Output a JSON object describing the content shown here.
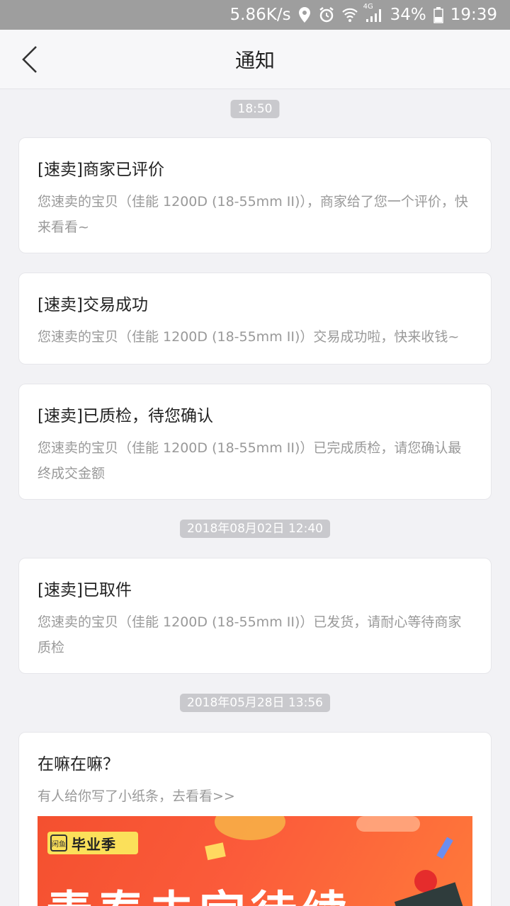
{
  "status_bar": {
    "speed": "5.86K/s",
    "network": "4G",
    "battery": "34%",
    "time": "19:39"
  },
  "nav": {
    "title": "通知",
    "back_icon": "chevron-left-icon"
  },
  "groups": [
    {
      "timestamp": "18:50",
      "notifications": [
        {
          "title": "[速卖]商家已评价",
          "body": "您速卖的宝贝（佳能 1200D (18-55mm II)），商家给了您一个评价，快来看看~"
        },
        {
          "title": "[速卖]交易成功",
          "body": "您速卖的宝贝（佳能 1200D (18-55mm II)）交易成功啦，快来收钱~"
        },
        {
          "title": "[速卖]已质检，待您确认",
          "body": "您速卖的宝贝（佳能 1200D (18-55mm II)）已完成质检，请您确认最终成交金额"
        }
      ]
    },
    {
      "timestamp": "2018年08月02日 12:40",
      "notifications": [
        {
          "title": "[速卖]已取件",
          "body": "您速卖的宝贝（佳能 1200D (18-55mm II)）已发货，请耐心等待商家质检"
        }
      ]
    },
    {
      "timestamp": "2018年05月28日 13:56",
      "notifications": [
        {
          "title": "在嘛在嘛？",
          "body": "有人给你写了小纸条，去看看>>",
          "banner": {
            "logo_mark": "闲鱼",
            "logo_text": "毕业季",
            "headline": "青春未完待续"
          }
        }
      ]
    }
  ],
  "colors": {
    "background": "#f2f2f5",
    "status_bar": "#9e9e9e",
    "timestamp_pill": "#c9c9cd",
    "body_text": "#999999",
    "banner": "#f4502f"
  }
}
